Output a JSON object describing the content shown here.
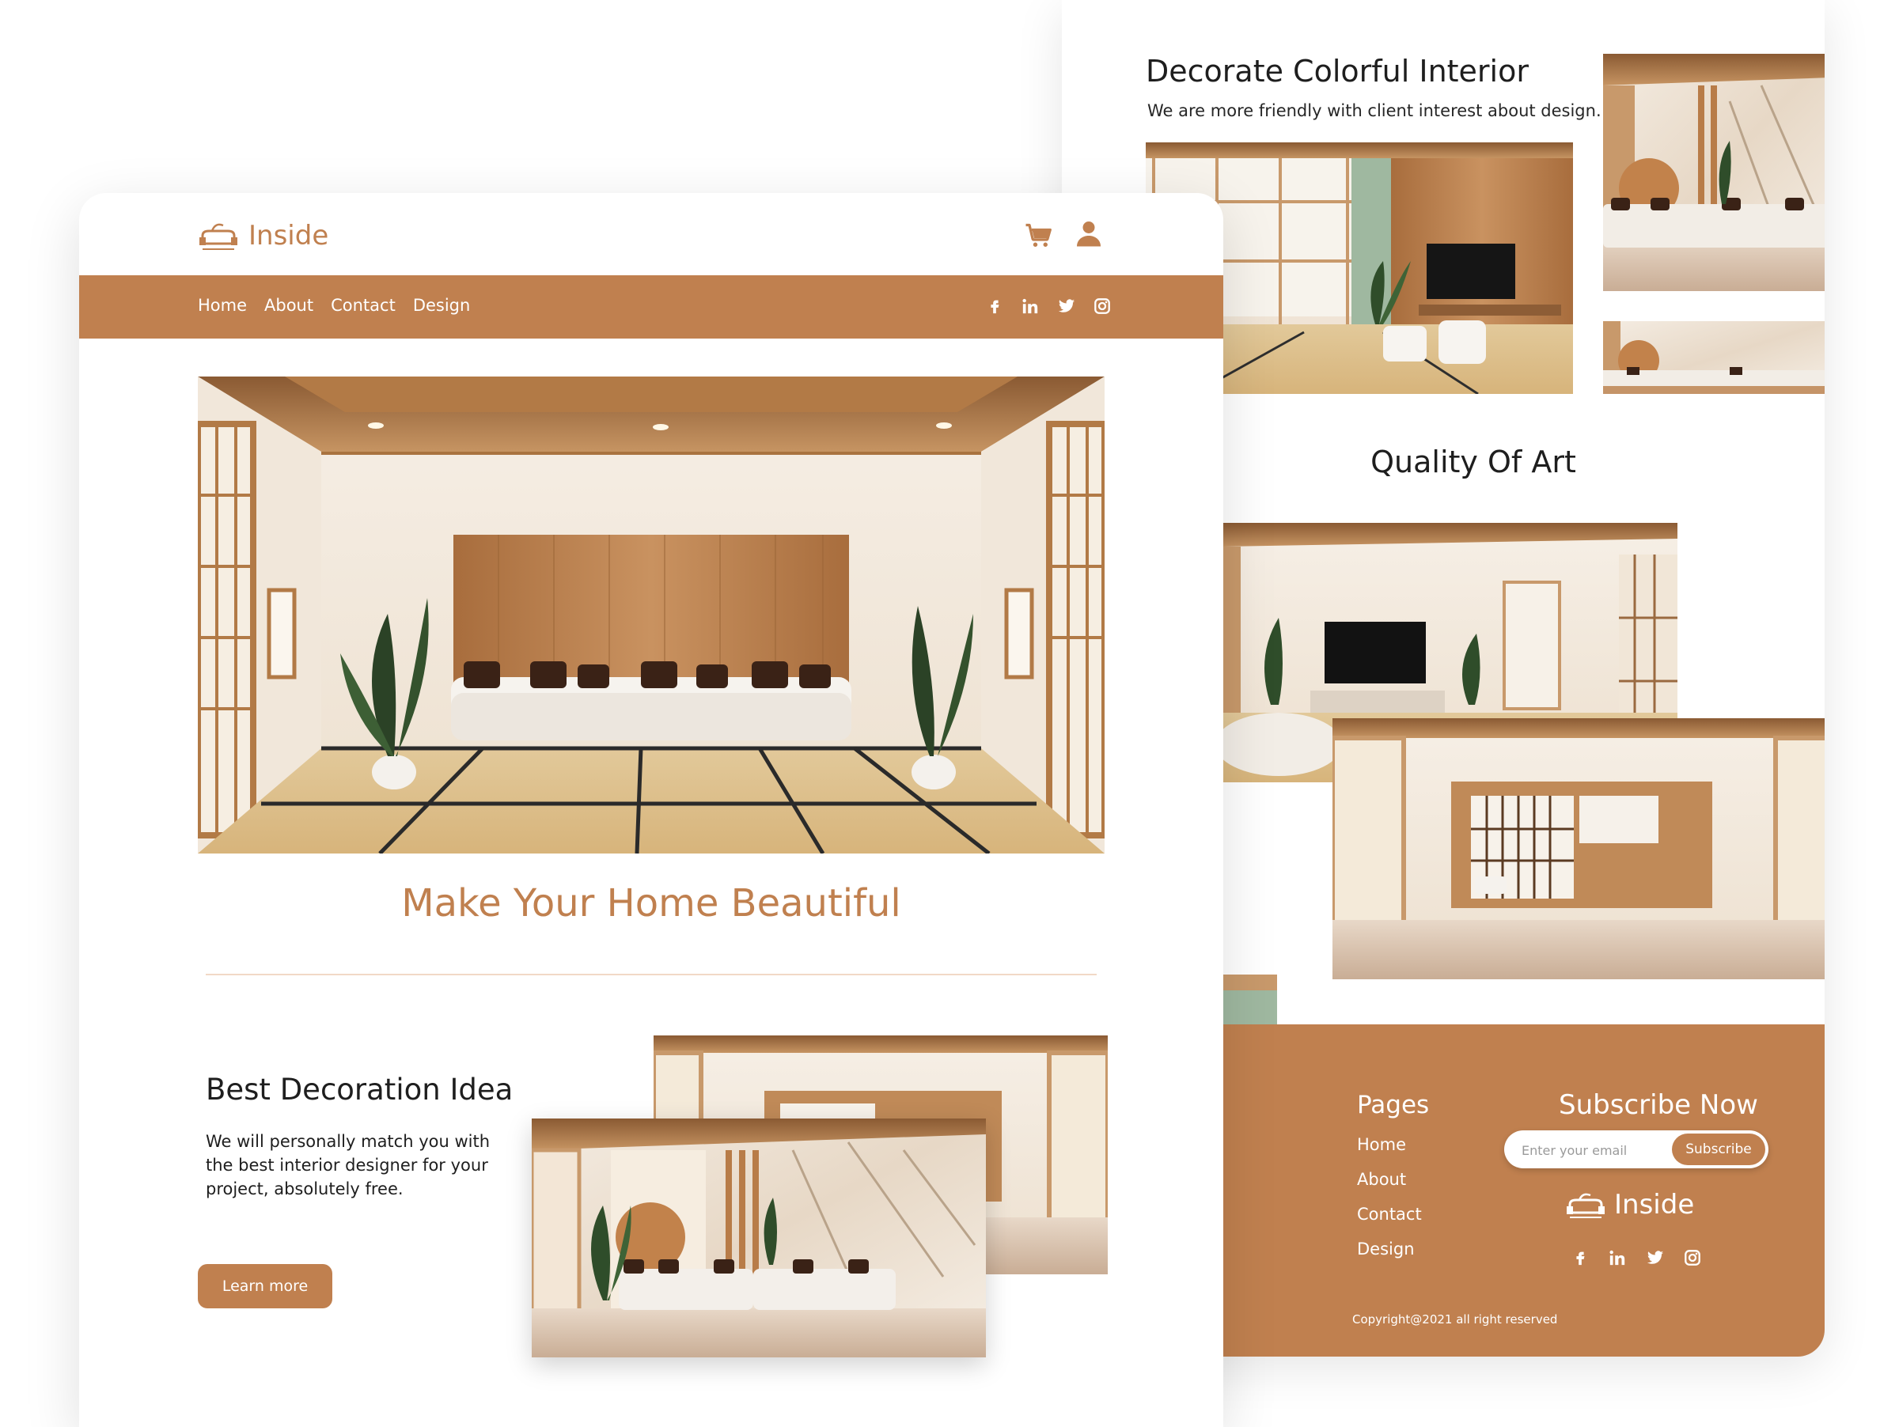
{
  "brand": {
    "name": "Inside",
    "logo_icon": "sofa-logo-icon"
  },
  "header": {
    "icons": [
      "cart-icon",
      "user-icon"
    ]
  },
  "nav": {
    "links": [
      "Home",
      "About",
      "Contact",
      "Design"
    ],
    "social": [
      "facebook-icon",
      "linkedin-icon",
      "twitter-icon",
      "instagram-icon"
    ]
  },
  "hero": {
    "headline": "Make Your Home Beautiful"
  },
  "decoration": {
    "title": "Best Decoration Idea",
    "body": "We will personally match you with the best interior designer for your project, absolutely free.",
    "button_label": "Learn more"
  },
  "colorful": {
    "title": "Decorate Colorful Interior",
    "subtitle": "We are more friendly with client interest about design."
  },
  "quality": {
    "title": "Quality Of Art"
  },
  "footer": {
    "pages_title": "Pages",
    "pages": [
      "Home",
      "About",
      "Contact",
      "Design"
    ],
    "subscribe_title": "Subscribe Now",
    "email_placeholder": "Enter your email",
    "subscribe_button": "Subscribe",
    "brand": "Inside",
    "copyright": "Copyright@2021 all right reserved"
  },
  "colors": {
    "accent": "#c0804f",
    "text": "#1c1c1c",
    "background": "#ffffff"
  }
}
